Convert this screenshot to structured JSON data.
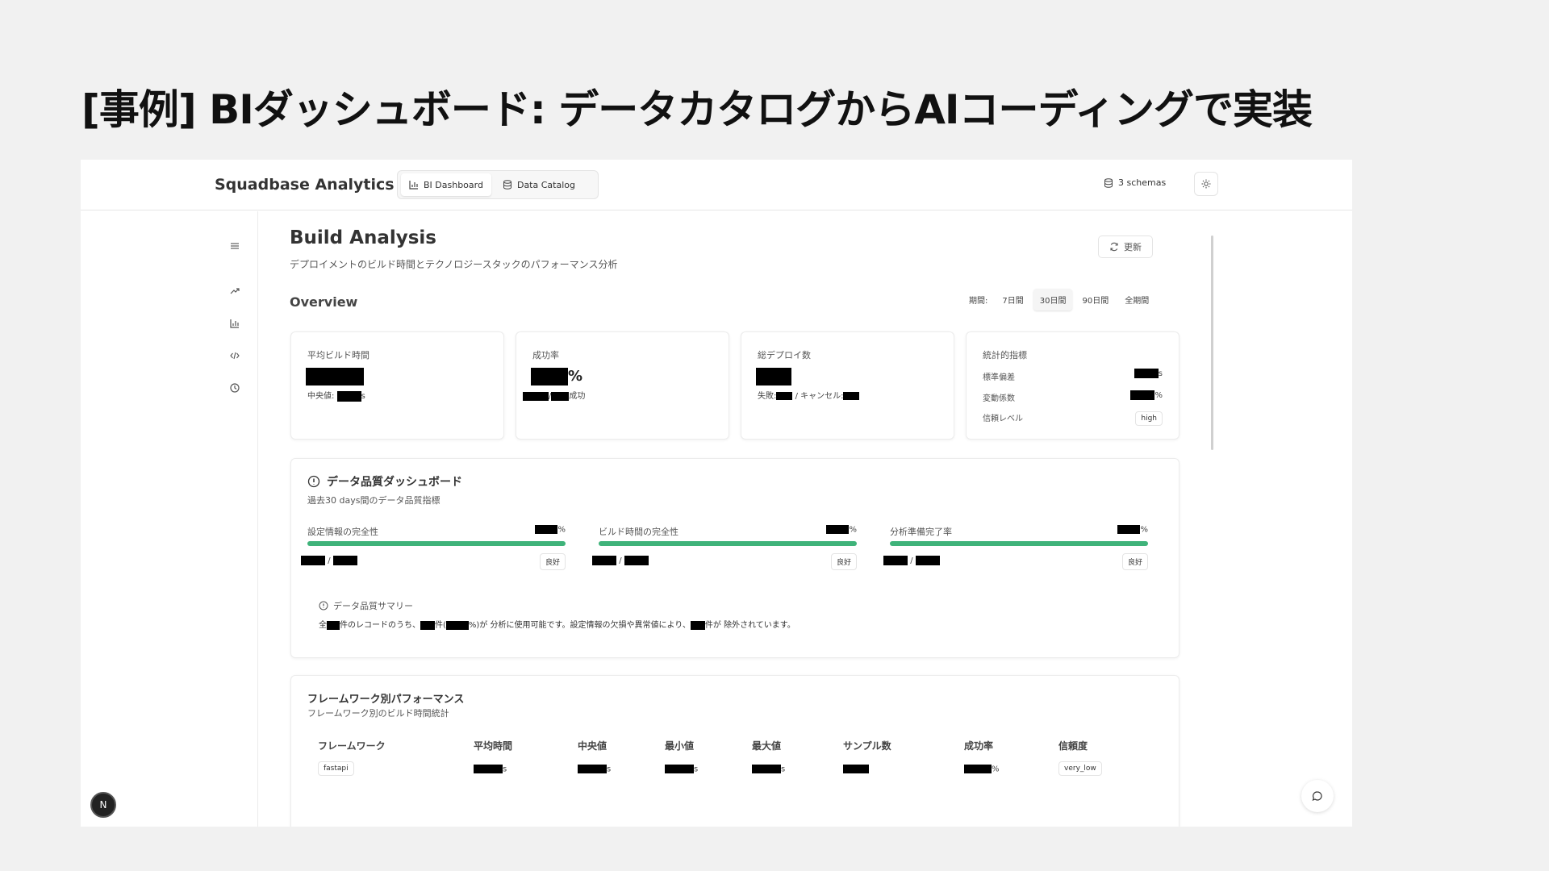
{
  "slide": {
    "title": "[事例] BIダッシュボード: データカタログからAIコーディングで実装"
  },
  "header": {
    "brand": "Squadbase Analytics",
    "tabs": [
      {
        "label": "BI Dashboard",
        "icon": "bar-chart-icon",
        "active": true
      },
      {
        "label": "Data Catalog",
        "icon": "database-icon",
        "active": false
      }
    ],
    "schemas": "3 schemas"
  },
  "sidebar": {
    "items": [
      "menu-icon",
      "trending-up-icon",
      "bar-chart-icon",
      "code-icon",
      "clock-icon"
    ]
  },
  "page": {
    "title": "Build Analysis",
    "subtitle": "デプロイメントのビルド時間とテクノロジースタックのパフォーマンス分析",
    "refresh": "更新",
    "overview": "Overview",
    "period_label": "期間:",
    "periods": [
      "7日間",
      "30日間",
      "90日間",
      "全期間"
    ],
    "selected_period": "30日間"
  },
  "stats": {
    "avg_build": {
      "label": "平均ビルド時間",
      "median_label": "中央値:",
      "unit": "s"
    },
    "success": {
      "label": "成功率",
      "unit": "%",
      "success_suffix": "成功",
      "sep": "/"
    },
    "deploys": {
      "label": "総デプロイ数",
      "fail_label": "失敗:",
      "cancel_label": "/ キャンセル:"
    },
    "metrics": {
      "label": "統計的指標",
      "rows": [
        {
          "label": "標準偏差",
          "unit": "s"
        },
        {
          "label": "変動係数",
          "unit": "%"
        },
        {
          "label": "信頼レベル",
          "badge": "high"
        }
      ]
    }
  },
  "quality": {
    "title": "データ品質ダッシュボード",
    "subtitle": "過去30 days間のデータ品質指標",
    "columns": [
      {
        "label": "設定情報の完全性",
        "unit": "%",
        "fill": 1.0,
        "badge": "良好",
        "sep": "/"
      },
      {
        "label": "ビルド時間の完全性",
        "unit": "%",
        "fill": 1.0,
        "badge": "良好",
        "sep": "/"
      },
      {
        "label": "分析準備完了率",
        "unit": "%",
        "fill": 1.0,
        "badge": "良好",
        "sep": "/"
      }
    ],
    "summary_title": "データ品質サマリー",
    "summary": {
      "p1": "全",
      "p2": "件のレコードのうち、",
      "p3": "件(",
      "p4": "%)が 分析に使用可能です。設定情報の欠損や異常値により、",
      "p5": "件が 除外されています。"
    }
  },
  "framework": {
    "title": "フレームワーク別パフォーマンス",
    "subtitle": "フレームワーク別のビルド時間統計",
    "headers": [
      "フレームワーク",
      "平均時間",
      "中央値",
      "最小値",
      "最大値",
      "サンプル数",
      "成功率",
      "信頼度"
    ],
    "row": {
      "framework": "fastapi",
      "unit_s": "s",
      "unit_pct": "%",
      "confidence": "very_low"
    }
  },
  "colors": {
    "accent_green": "#3fb37a",
    "redaction": "#000000"
  },
  "floating": {
    "n_badge": "N"
  }
}
